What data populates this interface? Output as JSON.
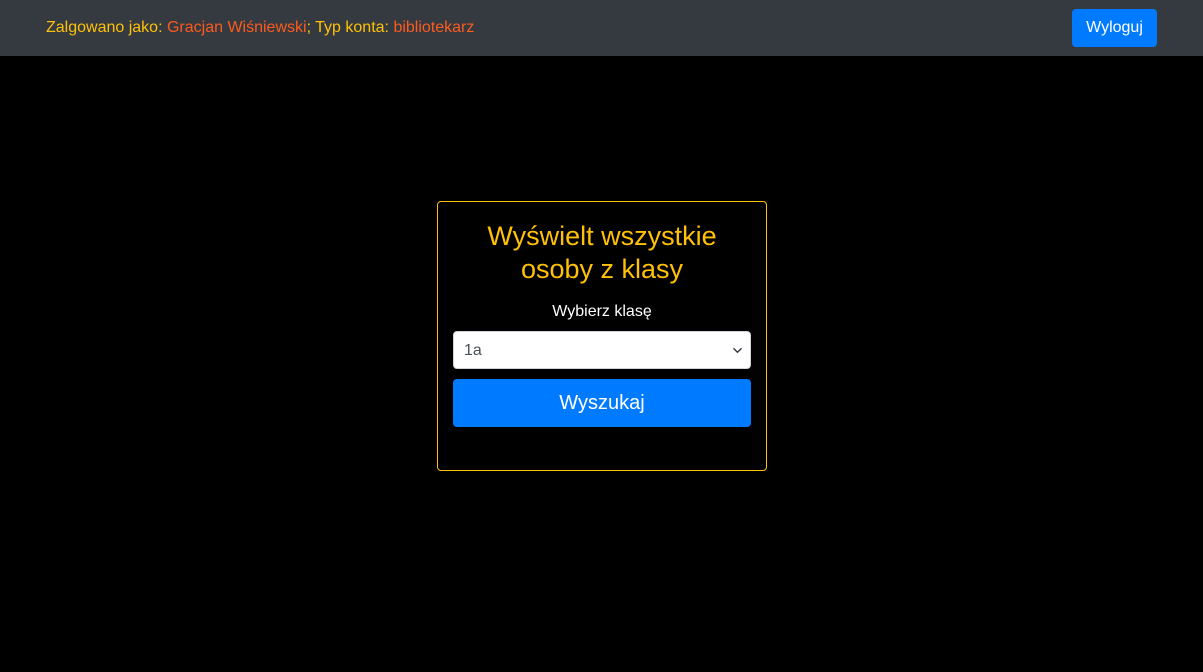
{
  "header": {
    "logged_in_label": "Zalgowano jako: ",
    "user_name": "Gracjan Wiśniewski",
    "account_type_label": "; Typ konta: ",
    "account_type": "bibliotekarz",
    "logout_label": "Wyloguj"
  },
  "form": {
    "title_line1": "Wyświelt wszystkie",
    "title_line2": "osoby z klasy",
    "class_label": "Wybierz klasę",
    "selected_class": "1a",
    "search_label": "Wyszukaj"
  },
  "colors": {
    "navbar_bg": "#343a40",
    "accent_yellow": "#ffc107",
    "value_orange": "#fd5a1e",
    "primary_blue": "#007bff",
    "page_bg": "#000000"
  },
  "icons": {
    "select_arrow": "chevron-down-icon"
  }
}
